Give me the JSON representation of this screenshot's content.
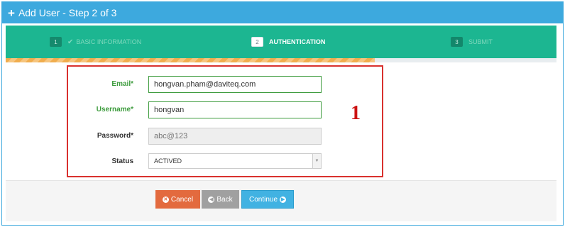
{
  "header": {
    "title": "Add User - Step 2 of 3",
    "icon": "plus-icon"
  },
  "wizard": {
    "steps": [
      {
        "number": "1",
        "label": "BASIC INFORMATION",
        "state": "done"
      },
      {
        "number": "2",
        "label": "AUTHENTICATION",
        "state": "active"
      },
      {
        "number": "3",
        "label": "SUBMIT",
        "state": "todo"
      }
    ],
    "progress_fraction": 0.67
  },
  "form": {
    "email": {
      "label": "Email*",
      "value": "hongvan.pham@daviteq.com"
    },
    "username": {
      "label": "Username*",
      "value": "hongvan"
    },
    "password": {
      "label": "Password*",
      "value": "abc@123"
    },
    "status": {
      "label": "Status",
      "selected": "ACTIVED"
    }
  },
  "annotation": "1",
  "buttons": {
    "cancel": "Cancel",
    "back": "Back",
    "continue": "Continue"
  },
  "colors": {
    "header": "#3da9de",
    "wizard": "#1cb691",
    "annotation_box": "#d9312e",
    "cancel": "#e36a3e",
    "back": "#a0a0a0",
    "continue": "#41b2e2"
  }
}
